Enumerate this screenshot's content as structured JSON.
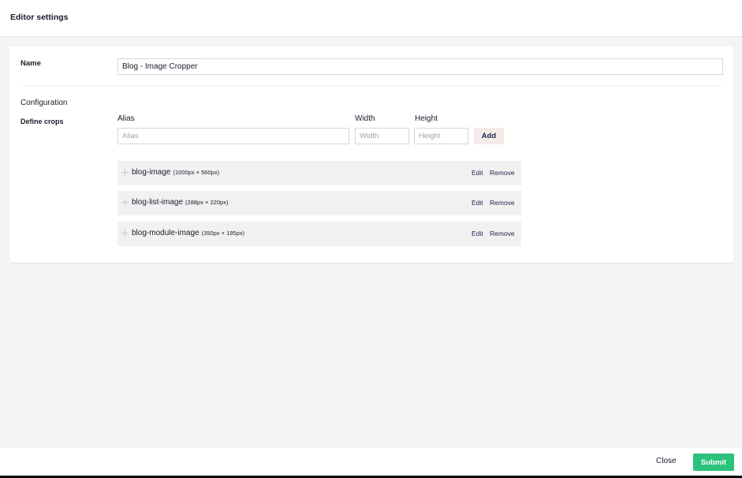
{
  "header": {
    "title": "Editor settings"
  },
  "properties": {
    "name_label": "Name",
    "name_value": "Blog - Image Cropper",
    "configuration_label": "Configuration",
    "define_crops_label": "Define crops"
  },
  "crop_form": {
    "alias_label": "Alias",
    "width_label": "Width",
    "height_label": "Height",
    "alias_placeholder": "Alias",
    "width_placeholder": "Width",
    "height_placeholder": "Height",
    "add_label": "Add"
  },
  "crops": [
    {
      "alias": "blog-image",
      "size": "(1000px × 560px)",
      "edit": "Edit",
      "remove": "Remove"
    },
    {
      "alias": "blog-list-image",
      "size": "(288px × 220px)",
      "edit": "Edit",
      "remove": "Remove"
    },
    {
      "alias": "blog-module-image",
      "size": "(350px × 195px)",
      "edit": "Edit",
      "remove": "Remove"
    }
  ],
  "footer": {
    "close_label": "Close",
    "submit_label": "Submit"
  },
  "colors": {
    "submit": "#2bc37c",
    "add_button": "#f3ece9",
    "background": "#f5f4f4"
  }
}
